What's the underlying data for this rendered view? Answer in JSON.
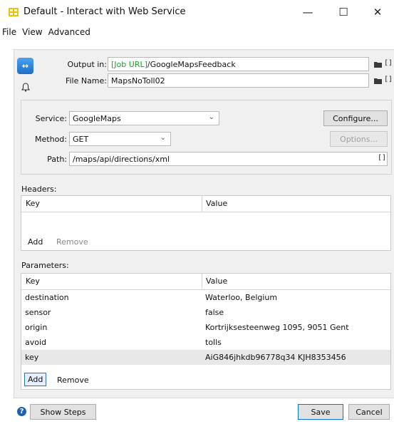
{
  "window": {
    "title": "Default - Interact with Web Service",
    "minimize_glyph": "—",
    "maximize_glyph": "☐",
    "close_glyph": "✕"
  },
  "menu": [
    "File",
    "View",
    "Advanced"
  ],
  "output": {
    "output_in_label": "Output in:",
    "output_in_var": "[Job URL]",
    "output_in_rest": "/GoogleMapsFeedback",
    "file_name_label": "File Name:",
    "file_name_value": "MapsNoToll02"
  },
  "request": {
    "service_label": "Service:",
    "service_value": "GoogleMaps",
    "method_label": "Method:",
    "method_value": "GET",
    "path_label": "Path:",
    "path_value": "/maps/api/directions/xml",
    "configure_label": "Configure...",
    "options_label": "Options..."
  },
  "headers": {
    "title": "Headers:",
    "columns": [
      "Key",
      "Value"
    ],
    "add_label": "Add",
    "remove_label": "Remove"
  },
  "parameters": {
    "title": "Parameters:",
    "columns": [
      "Key",
      "Value"
    ],
    "rows": [
      {
        "key": "destination",
        "value": "Waterloo, Belgium"
      },
      {
        "key": "sensor",
        "value": "false"
      },
      {
        "key": "origin",
        "value": "Kortrijksesteenweg 1095, 9051 Gent"
      },
      {
        "key": "avoid",
        "value": "tolls"
      },
      {
        "key": "key",
        "value": "AiG846jhkdb96778q34 KJH8353456"
      }
    ],
    "selected_index": 4,
    "add_label": "Add",
    "remove_label": "Remove"
  },
  "footer": {
    "help_glyph": "?",
    "show_steps_label": "Show Steps",
    "save_label": "Save",
    "cancel_label": "Cancel"
  },
  "colors": {
    "variable_green": "#1f9f2f",
    "accent_blue": "#0078d7",
    "panel_bg": "#f0f0f0"
  }
}
